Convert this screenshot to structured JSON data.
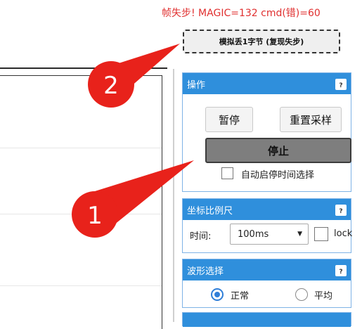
{
  "status": {
    "frame_error_text": "帧失步! MAGIC=132 cmd(错)=60"
  },
  "simulate": {
    "button_label": "模拟丢1字节 (复现失步)"
  },
  "panels": {
    "operation": {
      "title": "操作",
      "help": "?",
      "pause_label": "暂停",
      "reset_label": "重置采样",
      "stop_label": "停止",
      "auto_pause_label": "自动启停时间选择"
    },
    "scale": {
      "title": "坐标比例尺",
      "help": "?",
      "time_label": "时间:",
      "time_value": "100ms",
      "lock_label": "lock"
    },
    "waveform": {
      "title": "波形选择",
      "help": "?",
      "normal_label": "正常",
      "average_label": "平均",
      "selected": "正常"
    }
  },
  "annotations": {
    "marker_1": "1",
    "marker_2": "2",
    "color": "#e8221b"
  }
}
